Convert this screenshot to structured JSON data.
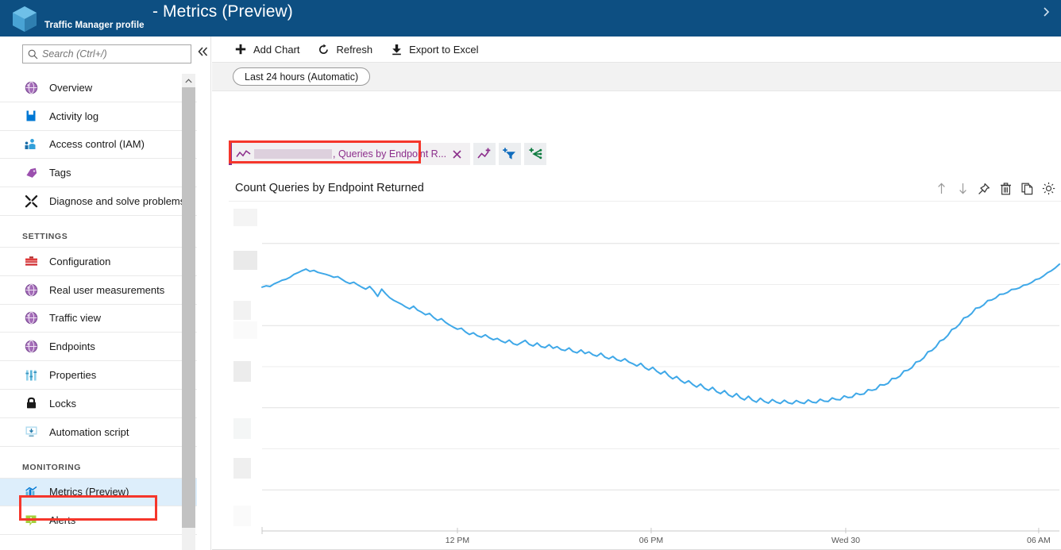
{
  "window": {
    "resource_name": "",
    "resource_type": "Traffic Manager profile",
    "blade_title": "- Metrics (Preview)",
    "close_icon": "chevron-close-icon",
    "logo_icon": "azure-cube-icon"
  },
  "sidebar": {
    "search": {
      "placeholder": "Search (Ctrl+/)",
      "value": "",
      "icon": "search-icon"
    },
    "collapse_icon": "double-chevron-left-icon",
    "items": [
      {
        "label": "Overview",
        "icon": "globe-icon",
        "color": "#9a5aa8",
        "selected": false
      },
      {
        "label": "Activity log",
        "icon": "activity-log-icon",
        "color": "#0078d4",
        "selected": false
      },
      {
        "label": "Access control (IAM)",
        "icon": "access-control-icon",
        "color": "#2c9cd6",
        "selected": false
      },
      {
        "label": "Tags",
        "icon": "tag-icon",
        "color": "#8c4fa0",
        "selected": false
      },
      {
        "label": "Diagnose and solve problems",
        "icon": "wrench-screwdriver-icon",
        "color": "#1a1a1a",
        "selected": false
      }
    ],
    "group_settings": "SETTINGS",
    "settings_items": [
      {
        "label": "Configuration",
        "icon": "toolbox-icon",
        "color": "#d13438",
        "selected": false
      },
      {
        "label": "Real user measurements",
        "icon": "globe-icon",
        "color": "#9a5aa8",
        "selected": false
      },
      {
        "label": "Traffic view",
        "icon": "globe-icon",
        "color": "#9a5aa8",
        "selected": false
      },
      {
        "label": "Endpoints",
        "icon": "globe-icon",
        "color": "#9a5aa8",
        "selected": false
      },
      {
        "label": "Properties",
        "icon": "properties-icon",
        "color": "#59b4d9",
        "selected": false
      },
      {
        "label": "Locks",
        "icon": "lock-icon",
        "color": "#1a1a1a",
        "selected": false
      },
      {
        "label": "Automation script",
        "icon": "automation-script-icon",
        "color": "#3999c6",
        "selected": false
      }
    ],
    "group_monitoring": "MONITORING",
    "monitoring_items": [
      {
        "label": "Metrics (Preview)",
        "icon": "bar-chart-icon",
        "color": "#0078d4",
        "selected": true
      },
      {
        "label": "Alerts",
        "icon": "alert-icon",
        "color": "#a4cf3a",
        "selected": false
      }
    ]
  },
  "toolbar": {
    "add_chart": "Add Chart",
    "add_chart_icon": "plus-icon",
    "refresh": "Refresh",
    "refresh_icon": "refresh-icon",
    "export": "Export to Excel",
    "export_icon": "download-icon"
  },
  "filterbar": {
    "time_range": "Last 24 hours (Automatic)"
  },
  "series_chip": {
    "spark_icon": "line-chart-icon",
    "redacted_resource": "",
    "metric_label": ", Queries by Endpoint R...",
    "close_icon": "close-icon",
    "actions": [
      {
        "name": "add-metric-icon",
        "icon": "add-line-chart-icon"
      },
      {
        "name": "add-filter-icon",
        "icon": "add-funnel-icon"
      },
      {
        "name": "apply-splitting-icon",
        "icon": "add-splitting-icon"
      }
    ]
  },
  "chart": {
    "title": "Count Queries by Endpoint Returned",
    "actions": [
      {
        "name": "move-up-button",
        "icon": "arrow-up-icon"
      },
      {
        "name": "move-down-button",
        "icon": "arrow-down-icon"
      },
      {
        "name": "pin-button",
        "icon": "pin-icon"
      },
      {
        "name": "delete-button",
        "icon": "trash-icon"
      },
      {
        "name": "duplicate-button",
        "icon": "copy-icon"
      },
      {
        "name": "settings-button",
        "icon": "gear-icon"
      }
    ],
    "line_color": "#3fa8e8"
  },
  "annotations": {
    "highlight_color": "#f5362b",
    "boxes": [
      {
        "name": "chart-title-highlight"
      },
      {
        "name": "metrics-nav-highlight"
      }
    ]
  },
  "chart_data": {
    "type": "line",
    "title": "Count Queries by Endpoint Returned",
    "xlabel": "",
    "ylabel": "",
    "legend": [
      ", Queries by Endpoint R..."
    ],
    "grid": true,
    "legend_position": "top",
    "xtick_labels": [
      "12 PM",
      "06 PM",
      "Wed 30",
      "06 AM"
    ],
    "xtick_positions_pct": [
      24.5,
      48.8,
      73.2,
      97.4
    ],
    "ytick_labels": [
      "",
      "",
      "",
      "",
      "",
      "",
      "",
      "",
      ""
    ],
    "ytick_note": "y-axis tick labels are redacted in the screenshot",
    "gridline_positions_pct": [
      12.5,
      25.0,
      37.5,
      50.0,
      62.5,
      75.0,
      87.5,
      100.0
    ],
    "ylim": [
      0,
      1
    ],
    "x": [
      0,
      1,
      2,
      3,
      4,
      5,
      6,
      7,
      8,
      9,
      10,
      11,
      12,
      13,
      14,
      15,
      16,
      17,
      18,
      19,
      20,
      21,
      22,
      23,
      24,
      25,
      26,
      27,
      28,
      29,
      30,
      31,
      32,
      33,
      34,
      35,
      36,
      37,
      38,
      39,
      40,
      41,
      42,
      43,
      44,
      45,
      46,
      47,
      48,
      49,
      50,
      51,
      52,
      53,
      54,
      55,
      56,
      57,
      58,
      59,
      60,
      61,
      62,
      63,
      64,
      65,
      66,
      67,
      68,
      69,
      70,
      71,
      72,
      73,
      74,
      75,
      76,
      77,
      78,
      79,
      80,
      81,
      82,
      83,
      84,
      85,
      86,
      87,
      88,
      89,
      90,
      91,
      92,
      93,
      94,
      95,
      96,
      97,
      98,
      99,
      100,
      101,
      102,
      103,
      104,
      105,
      106,
      107,
      108,
      109,
      110,
      111,
      112,
      113,
      114,
      115,
      116,
      117,
      118,
      119,
      120,
      121,
      122,
      123,
      124,
      125,
      126,
      127,
      128,
      129,
      130,
      131,
      132,
      133,
      134,
      135,
      136,
      137,
      138,
      139,
      140,
      141,
      142,
      143,
      144,
      145,
      146,
      147,
      148,
      149,
      150,
      151,
      152,
      153,
      154,
      155,
      156,
      157,
      158,
      159,
      160,
      161,
      162,
      163,
      164,
      165,
      166,
      167,
      168,
      169,
      170,
      171,
      172,
      173,
      174,
      175,
      176,
      177,
      178,
      179,
      180,
      181,
      182,
      183,
      184,
      185,
      186,
      187,
      188,
      189,
      190,
      191,
      192,
      193,
      194,
      195,
      196,
      197,
      198,
      199
    ],
    "y": [
      0.742,
      0.746,
      0.744,
      0.752,
      0.757,
      0.763,
      0.766,
      0.772,
      0.781,
      0.786,
      0.792,
      0.797,
      0.79,
      0.793,
      0.787,
      0.784,
      0.781,
      0.777,
      0.772,
      0.774,
      0.766,
      0.758,
      0.753,
      0.757,
      0.749,
      0.742,
      0.736,
      0.744,
      0.731,
      0.714,
      0.736,
      0.722,
      0.71,
      0.702,
      0.696,
      0.69,
      0.682,
      0.676,
      0.684,
      0.672,
      0.666,
      0.658,
      0.662,
      0.65,
      0.641,
      0.646,
      0.635,
      0.627,
      0.62,
      0.614,
      0.617,
      0.606,
      0.598,
      0.603,
      0.594,
      0.59,
      0.597,
      0.588,
      0.582,
      0.586,
      0.578,
      0.573,
      0.581,
      0.57,
      0.566,
      0.573,
      0.58,
      0.568,
      0.563,
      0.572,
      0.561,
      0.558,
      0.567,
      0.556,
      0.561,
      0.552,
      0.549,
      0.557,
      0.546,
      0.542,
      0.551,
      0.54,
      0.545,
      0.536,
      0.532,
      0.541,
      0.529,
      0.524,
      0.531,
      0.521,
      0.517,
      0.524,
      0.514,
      0.509,
      0.502,
      0.51,
      0.497,
      0.49,
      0.498,
      0.486,
      0.478,
      0.486,
      0.472,
      0.463,
      0.47,
      0.458,
      0.45,
      0.457,
      0.446,
      0.438,
      0.447,
      0.434,
      0.428,
      0.437,
      0.424,
      0.418,
      0.427,
      0.414,
      0.408,
      0.418,
      0.405,
      0.399,
      0.41,
      0.398,
      0.392,
      0.404,
      0.394,
      0.389,
      0.4,
      0.392,
      0.388,
      0.398,
      0.39,
      0.387,
      0.397,
      0.391,
      0.388,
      0.399,
      0.392,
      0.39,
      0.401,
      0.395,
      0.394,
      0.405,
      0.4,
      0.399,
      0.411,
      0.406,
      0.407,
      0.419,
      0.415,
      0.417,
      0.43,
      0.428,
      0.431,
      0.445,
      0.444,
      0.449,
      0.464,
      0.464,
      0.471,
      0.487,
      0.489,
      0.497,
      0.514,
      0.517,
      0.527,
      0.545,
      0.549,
      0.56,
      0.578,
      0.583,
      0.595,
      0.613,
      0.618,
      0.63,
      0.648,
      0.652,
      0.662,
      0.678,
      0.68,
      0.688,
      0.701,
      0.703,
      0.709,
      0.72,
      0.721,
      0.726,
      0.735,
      0.736,
      0.74,
      0.748,
      0.75,
      0.756,
      0.765,
      0.768,
      0.776,
      0.786,
      0.792,
      0.801,
      0.812
    ]
  }
}
